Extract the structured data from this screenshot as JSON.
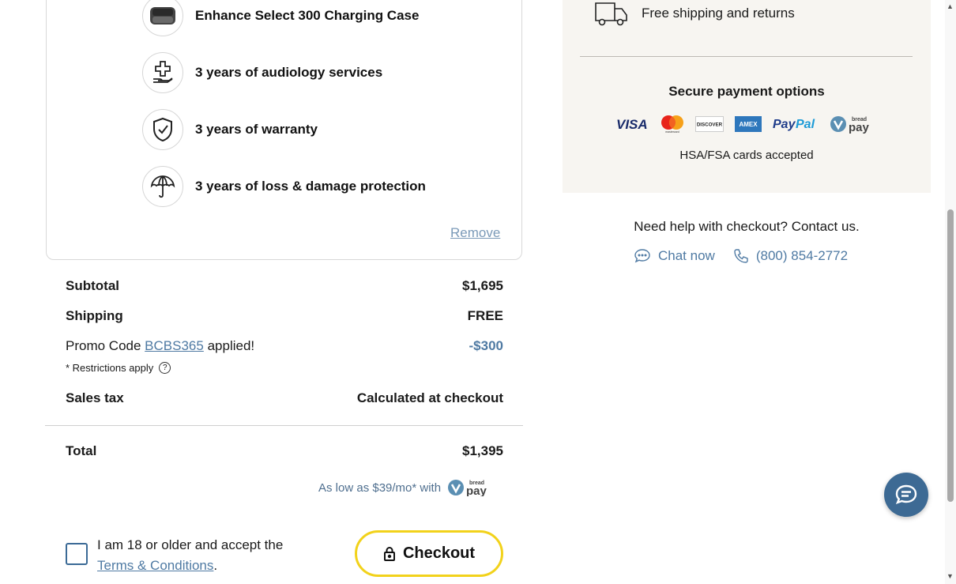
{
  "features": [
    {
      "icon": "charging-case-icon",
      "label": "Enhance Select 300 Charging Case"
    },
    {
      "icon": "hand-cross-icon",
      "label": "3 years of audiology services"
    },
    {
      "icon": "shield-check-icon",
      "label": "3 years of warranty"
    },
    {
      "icon": "umbrella-icon",
      "label": "3 years of loss & damage protection"
    }
  ],
  "remove_label": "Remove",
  "summary": {
    "subtotal_label": "Subtotal",
    "subtotal_value": "$1,695",
    "shipping_label": "Shipping",
    "shipping_value": "FREE",
    "promo_prefix": "Promo Code",
    "promo_code": "BCBS365",
    "promo_suffix": "applied!",
    "promo_value": "-$300",
    "restrictions": "* Restrictions apply",
    "restrictions_icon": "question-icon",
    "tax_label": "Sales tax",
    "tax_value": "Calculated at checkout",
    "total_label": "Total",
    "total_value": "$1,395",
    "financing": "As low as $39/mo* with"
  },
  "consent": {
    "text": "I am 18 or older and accept the",
    "link": "Terms & Conditions",
    "period": "."
  },
  "checkout_label": "Checkout",
  "right": {
    "shipping_text": "Free shipping and returns",
    "secure_title": "Secure payment options",
    "payment_logos": [
      "VISA",
      "mastercard",
      "DISCOVER",
      "AMEX",
      "PayPal",
      "bread pay"
    ],
    "hsa": "HSA/FSA cards accepted",
    "help": "Need help with checkout? Contact us.",
    "chat": "Chat now",
    "phone": "(800) 854-2772"
  },
  "colors": {
    "accent": "#4f7aa3",
    "checkout_border": "#f2d21b",
    "panel_bg": "#f7f5f1",
    "fab": "#3d6a94"
  }
}
